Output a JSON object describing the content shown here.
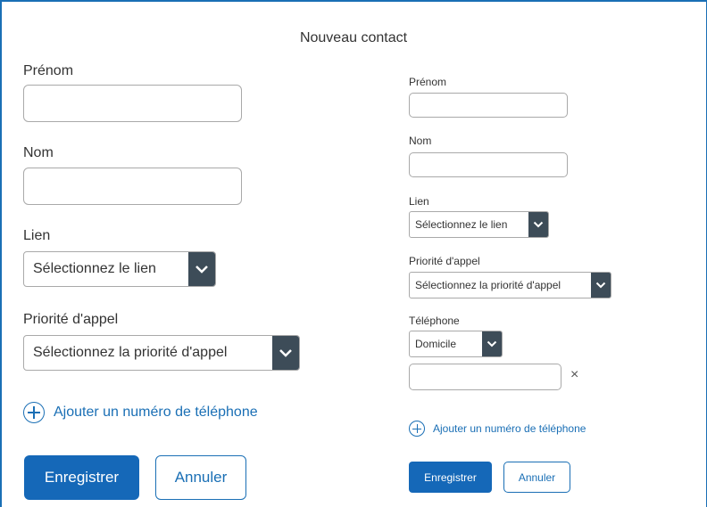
{
  "title": "Nouveau contact",
  "large_form": {
    "first_name_label": "Prénom",
    "first_name_value": "",
    "last_name_label": "Nom",
    "last_name_value": "",
    "link_label": "Lien",
    "link_select": "Sélectionnez le lien",
    "call_priority_label": "Priorité d'appel",
    "call_priority_select": "Sélectionnez la priorité d'appel",
    "add_phone": "Ajouter un numéro de téléphone",
    "save": "Enregistrer",
    "cancel": "Annuler"
  },
  "small_form": {
    "first_name_label": "Prénom",
    "first_name_value": "",
    "last_name_label": "Nom",
    "last_name_value": "",
    "link_label": "Lien",
    "link_select": "Sélectionnez le lien",
    "call_priority_label": "Priorité d'appel",
    "call_priority_select": "Sélectionnez la priorité d'appel",
    "phone_label": "Téléphone",
    "phone_type_select": "Domicile",
    "phone_value": "",
    "remove_phone": "×",
    "add_phone": "Ajouter un numéro de téléphone",
    "save": "Enregistrer",
    "cancel": "Annuler"
  },
  "colors": {
    "accent": "#1568b8",
    "select_arrow_bg": "#3d4c58",
    "frame_border": "#1a6fb5"
  }
}
